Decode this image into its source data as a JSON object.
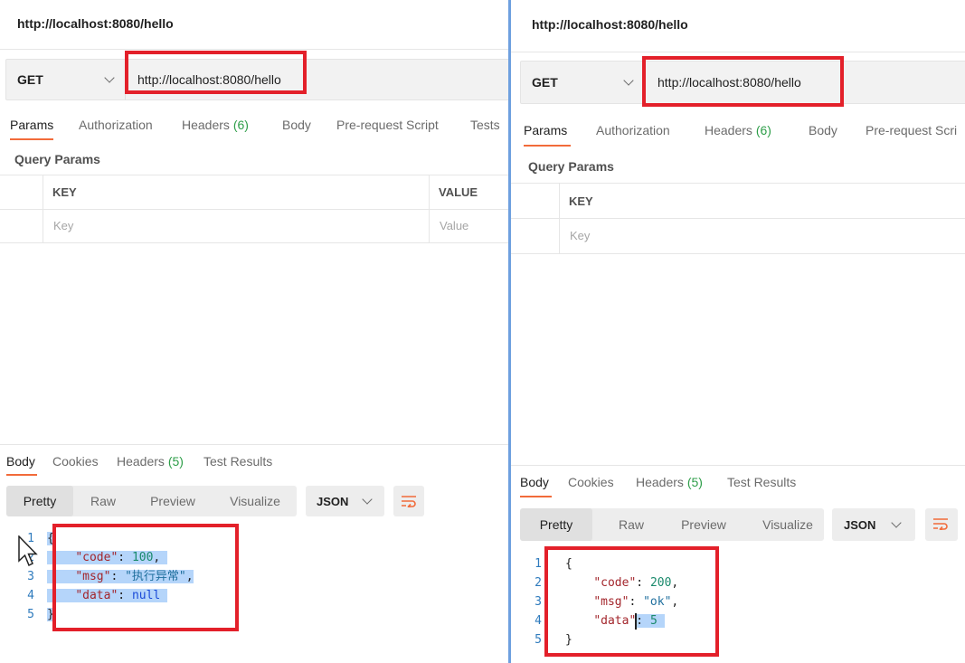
{
  "left": {
    "tab_title": "http://localhost:8080/hello",
    "method": "GET",
    "url": "http://localhost:8080/hello",
    "request_tabs": [
      {
        "label": "Params",
        "count": ""
      },
      {
        "label": "Authorization",
        "count": ""
      },
      {
        "label": "Headers",
        "count": "(6)"
      },
      {
        "label": "Body",
        "count": ""
      },
      {
        "label": "Pre-request Script",
        "count": ""
      },
      {
        "label": "Tests",
        "count": ""
      }
    ],
    "query_params_label": "Query Params",
    "key_header": "KEY",
    "value_header": "VALUE",
    "key_placeholder": "Key",
    "value_placeholder": "Value",
    "response_tabs": [
      {
        "label": "Body",
        "count": ""
      },
      {
        "label": "Cookies",
        "count": ""
      },
      {
        "label": "Headers",
        "count": "(5)"
      },
      {
        "label": "Test Results",
        "count": ""
      }
    ],
    "view_modes": [
      "Pretty",
      "Raw",
      "Preview",
      "Visualize"
    ],
    "format": "JSON",
    "code": {
      "open": "{",
      "close": "}",
      "lines": [
        {
          "key": "\"code\"",
          "value": "100",
          "type": "num",
          "comma": ","
        },
        {
          "key": "\"msg\"",
          "value": "\"执行异常\"",
          "type": "str",
          "comma": ","
        },
        {
          "key": "\"data\"",
          "value": "null",
          "type": "nul",
          "comma": ""
        }
      ]
    }
  },
  "right": {
    "tab_title": "http://localhost:8080/hello",
    "method": "GET",
    "url": "http://localhost:8080/hello",
    "request_tabs": [
      {
        "label": "Params",
        "count": ""
      },
      {
        "label": "Authorization",
        "count": ""
      },
      {
        "label": "Headers",
        "count": "(6)"
      },
      {
        "label": "Body",
        "count": ""
      },
      {
        "label": "Pre-request Scri",
        "count": ""
      }
    ],
    "query_params_label": "Query Params",
    "key_header": "KEY",
    "key_placeholder": "Key",
    "response_tabs": [
      {
        "label": "Body",
        "count": ""
      },
      {
        "label": "Cookies",
        "count": ""
      },
      {
        "label": "Headers",
        "count": "(5)"
      },
      {
        "label": "Test Results",
        "count": ""
      }
    ],
    "view_modes": [
      "Pretty",
      "Raw",
      "Preview",
      "Visualize"
    ],
    "format": "JSON",
    "code": {
      "open": "{",
      "close": "}",
      "lines": [
        {
          "key": "\"code\"",
          "value": "200",
          "type": "num",
          "comma": ","
        },
        {
          "key": "\"msg\"",
          "value": "\"ok\"",
          "type": "str",
          "comma": ","
        },
        {
          "key": "\"data\"",
          "value": "5",
          "type": "num",
          "comma": ""
        }
      ]
    }
  },
  "icons": {
    "method_dropdown": "chevron-down-icon",
    "format_dropdown": "chevron-down-icon",
    "wrap": "wrap-lines-icon",
    "cursor": "mouse-cursor-icon"
  },
  "colors": {
    "highlight_box": "#e3202a",
    "active_tab": "#f26b3a",
    "count": "#2e9e49",
    "selection": "#b5d5fa"
  }
}
